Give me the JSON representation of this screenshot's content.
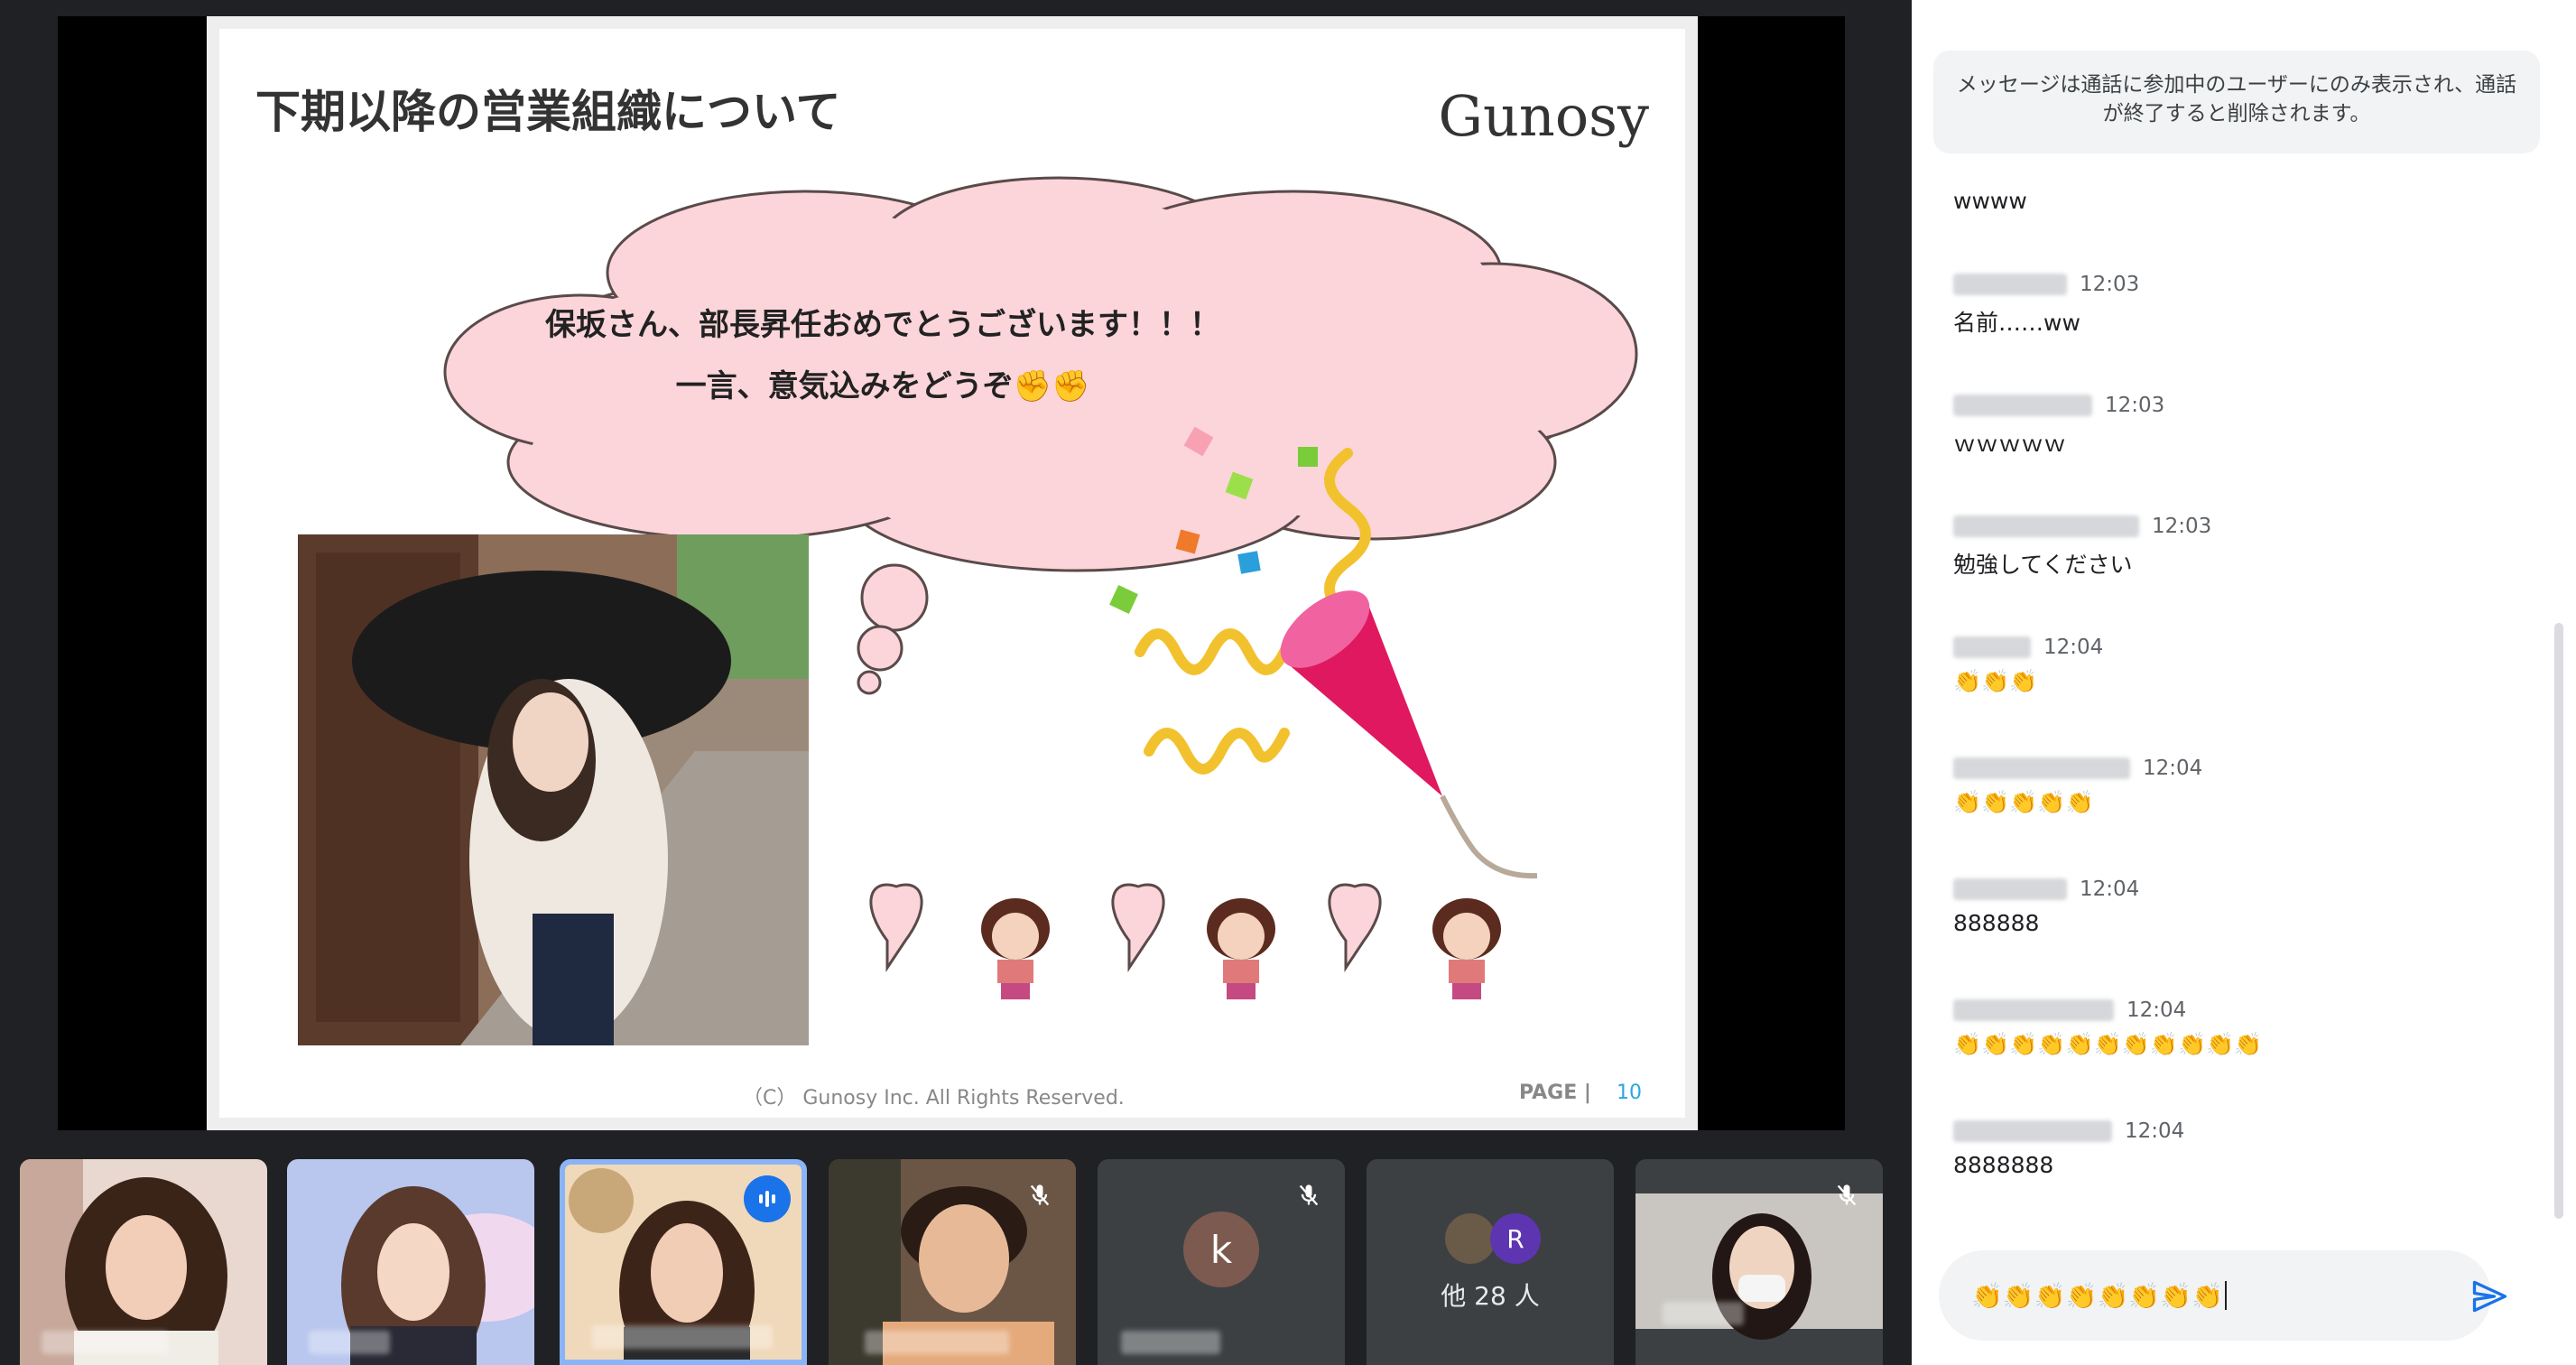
{
  "slide": {
    "title": "下期以降の営業組織について",
    "logo": "Gunosy",
    "cloud_line1": "保坂さん、部長昇任おめでとうございます！！！",
    "cloud_line2": "一言、意気込みをどうぞ✊✊",
    "footer": "（C） Gunosy Inc. All Rights Reserved.",
    "page_label": "PAGE |",
    "page_number": "10"
  },
  "chat": {
    "notice": "メッセージは通話に参加中のユーザーにのみ表示され、通話が終了すると削除されます。",
    "messages": [
      {
        "time": "",
        "text": "wwww"
      },
      {
        "time": "12:03",
        "text": "名前……ww"
      },
      {
        "time": "12:03",
        "text": "ｗｗｗｗｗ"
      },
      {
        "time": "12:03",
        "text": "勉強してください"
      },
      {
        "time": "12:04",
        "text": "👏👏👏"
      },
      {
        "time": "12:04",
        "text": "👏👏👏👏👏"
      },
      {
        "time": "12:04",
        "text": "888888"
      },
      {
        "time": "12:04",
        "text": "👏👏👏👏👏👏👏👏👏👏👏"
      },
      {
        "time": "12:04",
        "text": "8888888"
      }
    ],
    "compose_value": "👏👏👏👏👏👏👏👏"
  },
  "participants": {
    "others_count": "他 28 人",
    "avatar_k": "k",
    "avatar_r": "R"
  },
  "colors": {
    "accent": "#1a73e8",
    "cloud_fill": "#fbd5da",
    "popper_pink": "#e0185f",
    "active_border": "#8ab4f8"
  }
}
